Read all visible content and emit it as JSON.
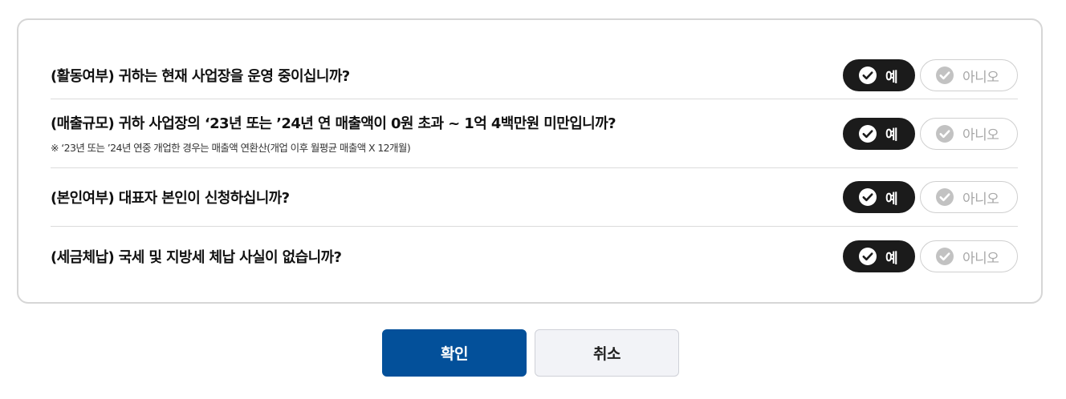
{
  "questions": [
    {
      "title": "(활동여부) 귀하는 현재 사업장을 운영 중이십니까?",
      "note": "",
      "selected": "예"
    },
    {
      "title": "(매출규모) 귀하 사업장의 ‘23년 또는 ’24년 연 매출액이 0원 초과 ~ 1억 4백만원 미만입니까?",
      "note": "※ ‘23년 또는 ’24년 연중 개업한 경우는 매출액 연환산(개업 이후 월평균 매출액 X 12개월)",
      "selected": "예"
    },
    {
      "title": "(본인여부) 대표자 본인이 신청하십니까?",
      "note": "",
      "selected": "예"
    },
    {
      "title": "(세금체납) 국세 및 지방세 체납 사실이 없습니까?",
      "note": "",
      "selected": "예"
    }
  ],
  "options": {
    "yes_label": "예",
    "no_label": "아니오"
  },
  "actions": {
    "confirm_label": "확인",
    "cancel_label": "취소"
  },
  "colors": {
    "selected_bg": "#1b1b1b",
    "unselected_text": "#a8a8a8",
    "confirm_bg": "#03509a",
    "cancel_bg": "#f2f3f7"
  }
}
